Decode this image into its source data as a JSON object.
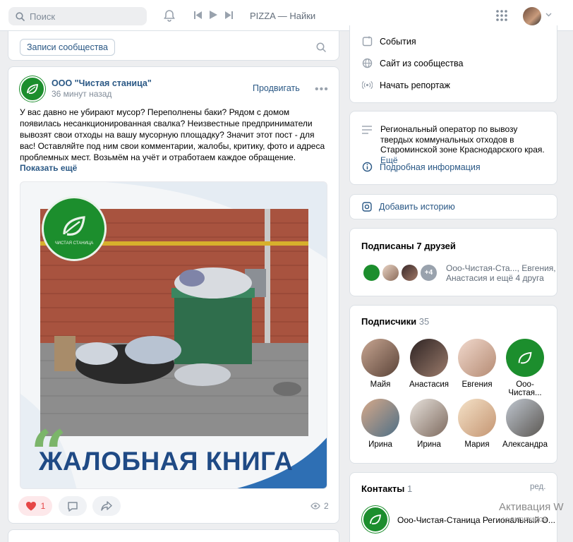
{
  "header": {
    "search_placeholder": "Поиск",
    "now_playing": "PIZZA — Найки"
  },
  "wall": {
    "chip_label": "Записи сообщества"
  },
  "post": {
    "author": "ООО \"Чистая станица\"",
    "time": "36 минут назад",
    "promote_label": "Продвигать",
    "text": "У вас давно не убирают мусор? Переполнены баки? Рядом с домом появилась несанкционированная свалка? Неизвестные предприниматели вывозят свои отходы на вашу мусорную площадку? Значит этот пост - для вас! Оставляйте под ним свои комментарии, жалобы, критику, фото и адреса проблемных мест. Возьмём на учёт и отработаем каждое обращение.",
    "show_more": "Показать ещё",
    "image_title": "ЖАЛОБНАЯ КНИГА",
    "logo_caption": "ЧИСТАЯ СТАНИЦА",
    "likes": "1",
    "views": "2"
  },
  "menu": {
    "events": "События",
    "site": "Сайт из сообщества",
    "report": "Начать репортаж"
  },
  "info": {
    "description": "Региональный оператор по вывозу твердых коммунальных отходов в Староминской зоне Краснодарского края.",
    "more": "Ещё",
    "details": "Подробная информация"
  },
  "story": {
    "label": "Добавить историю"
  },
  "friends": {
    "title": "Подписаны 7 друзей",
    "extra_badge": "+4",
    "text_line1": "Ооо-Чистая-Ста..., Евгения,",
    "text_line2": "Анастасия и ещё 4 друга"
  },
  "subscribers": {
    "title": "Подписчики",
    "count": "35",
    "list": [
      {
        "name": "Майя"
      },
      {
        "name": "Анастасия"
      },
      {
        "name": "Евгения"
      },
      {
        "name": "Ооо-Чистая..."
      },
      {
        "name": "Ирина"
      },
      {
        "name": "Ирина"
      },
      {
        "name": "Мария"
      },
      {
        "name": "Александра"
      }
    ]
  },
  "contacts": {
    "title": "Контакты",
    "count": "1",
    "edit": "ред.",
    "name": "Ооо-Чистая-Станица Региональный О..."
  },
  "watermark": {
    "line1": "Активация W",
    "line2": "ы активиров"
  },
  "colors": {
    "accent": "#2a5885",
    "brand_green": "#1c8e2d",
    "like_red": "#e64646"
  }
}
